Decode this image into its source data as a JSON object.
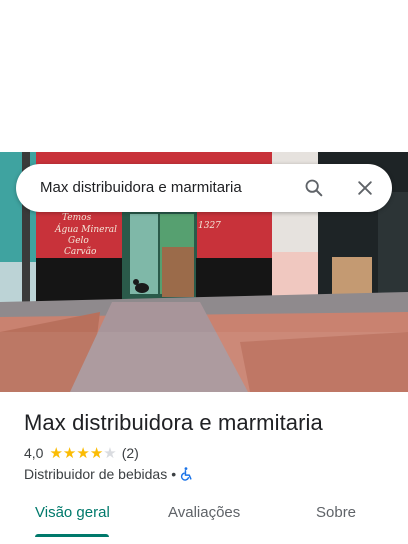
{
  "search": {
    "query": "Max distribuidora e marmitaria"
  },
  "hero": {
    "storefront_words": [
      "Temos",
      "Água Mineral",
      "Gelo",
      "Carvão"
    ],
    "number_sign": "1327"
  },
  "place": {
    "name": "Max distribuidora e marmitaria",
    "rating": "4,0",
    "stars_filled": 4,
    "stars_total": 5,
    "review_count": "(2)",
    "category": "Distribuidor de bebidas",
    "separator": "•"
  },
  "tabs": [
    {
      "label": "Visão geral",
      "active": true
    },
    {
      "label": "Avaliações",
      "active": false
    },
    {
      "label": "Sobre",
      "active": false
    }
  ],
  "colors": {
    "accent": "#00796b",
    "star": "#fbbc04",
    "accessibility_icon": "#1a73e8"
  }
}
